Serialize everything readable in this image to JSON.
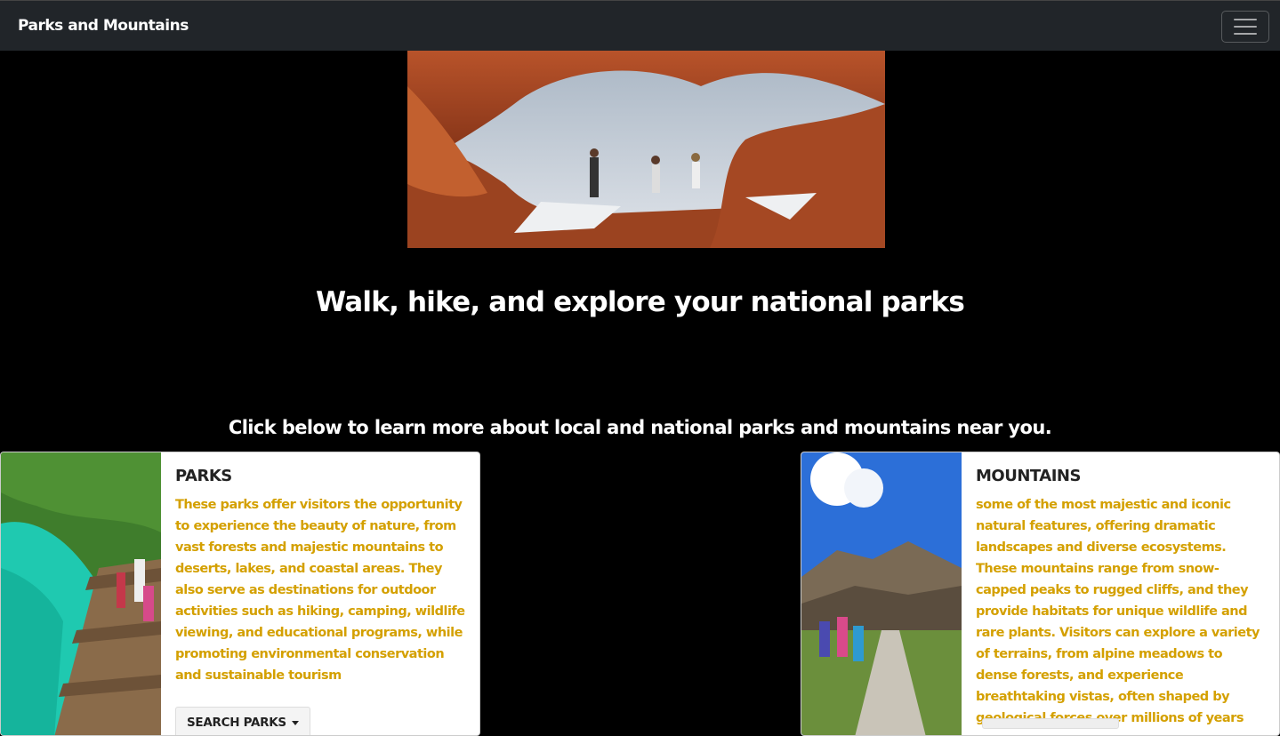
{
  "navbar": {
    "brand": "Parks and Mountains",
    "toggler_icon": "hamburger-icon"
  },
  "hero": {
    "image": "hikers-under-red-rock-arch"
  },
  "headline": "Walk, hike, and explore your national parks",
  "subheadline": "Click below to learn more about local and national parks and mountains near you.",
  "cards": {
    "parks": {
      "image": "boardwalk-turquoise-lake",
      "title": "PARKS",
      "description": "These parks offer visitors the opportunity to experience the beauty of nature, from vast forests and majestic mountains to deserts, lakes, and coastal areas. They also serve as destinations for outdoor activities such as hiking, camping, wildlife viewing, and educational programs, while promoting environmental conservation and sustainable tourism",
      "button_label": "SEARCH PARKS"
    },
    "mountains": {
      "image": "hikers-mountain-trail",
      "title": "MOUNTAINS",
      "description": "some of the most majestic and iconic natural features, offering dramatic landscapes and diverse ecosystems. These mountains range from snow-capped peaks to rugged cliffs, and they provide habitats for unique wildlife and rare plants. Visitors can explore a variety of terrains, from alpine meadows to dense forests, and experience breathtaking vistas, often shaped by geological forces over millions of years"
    }
  },
  "colors": {
    "navbar_bg": "#212529",
    "page_bg": "#000000",
    "description_text": "#d4a000"
  }
}
